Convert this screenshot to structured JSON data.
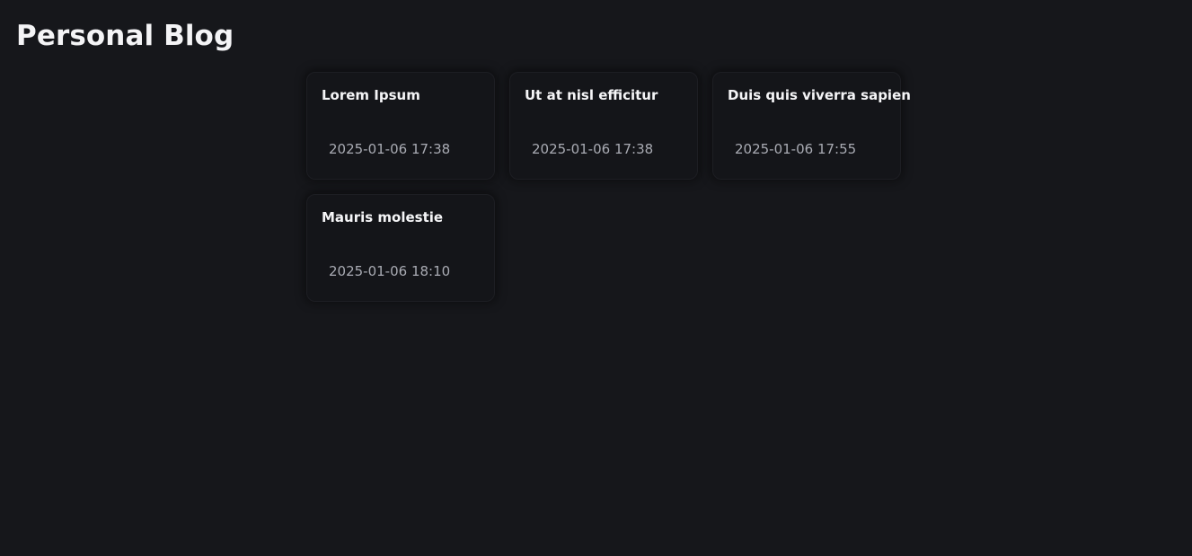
{
  "header": {
    "title": "Personal Blog"
  },
  "posts": [
    {
      "title": "Lorem Ipsum",
      "date": "2025-01-06 17:38"
    },
    {
      "title": "Ut at nisl efficitur",
      "date": "2025-01-06 17:38"
    },
    {
      "title": "Duis quis viverra sapien",
      "date": "2025-01-06 17:55"
    },
    {
      "title": "Mauris molestie",
      "date": "2025-01-06 18:10"
    }
  ],
  "colors": {
    "background": "#16171b",
    "card": "#141519",
    "text": "#f5f5f7",
    "muted": "#a9abb3"
  }
}
